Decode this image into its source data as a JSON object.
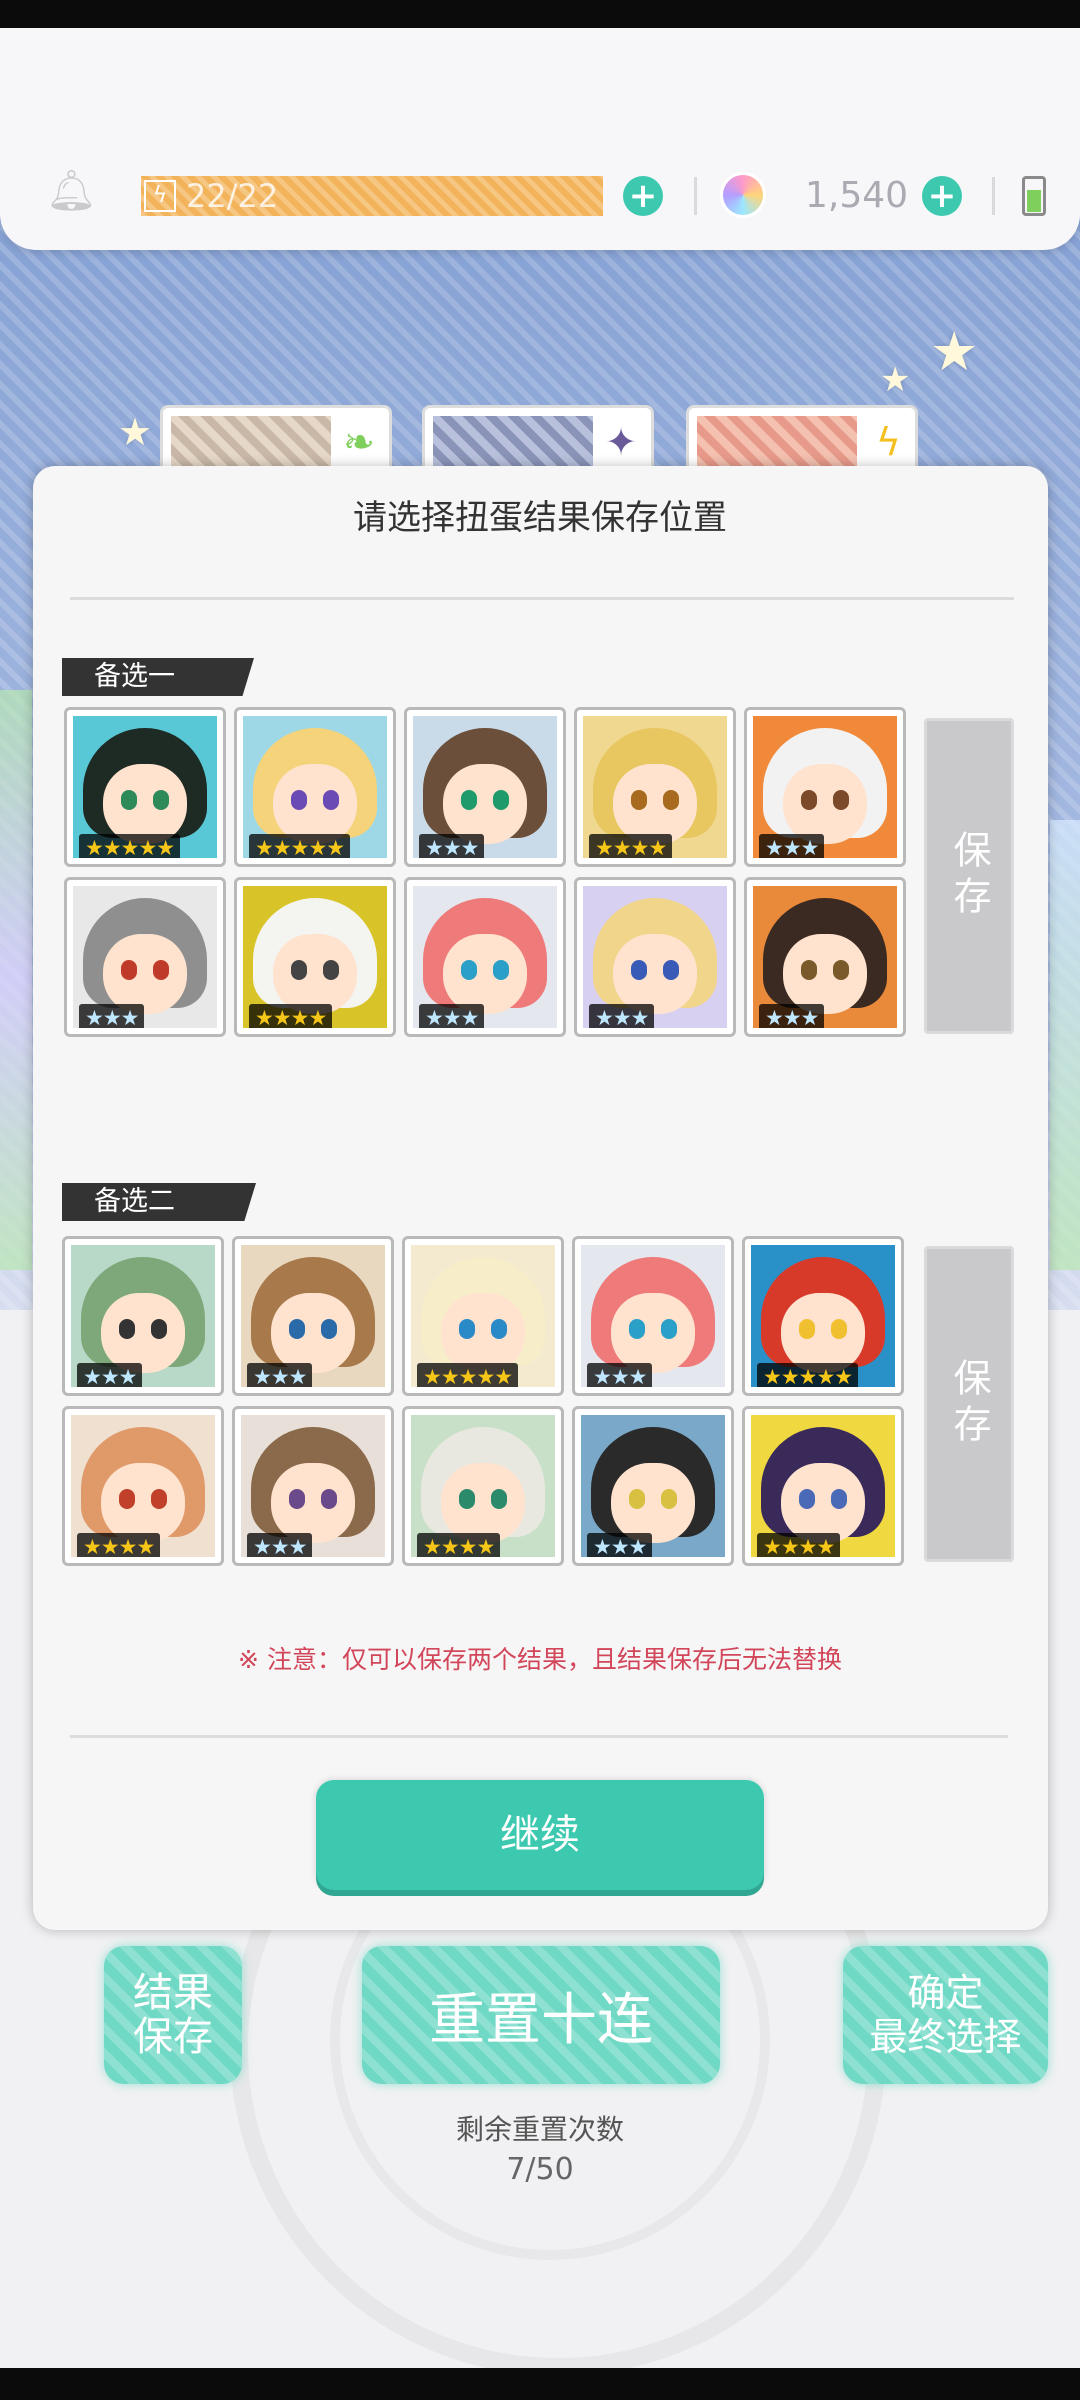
{
  "hud": {
    "stamina": "22/22",
    "gems": "1,540"
  },
  "dialog": {
    "title": "请选择扭蛋结果保存位置",
    "note": "※ 注意：仅可以保存两个结果，且结果保存后无法替换",
    "continue_label": "继续",
    "groups": [
      {
        "label": "备选一",
        "save_label": "保存",
        "characters": [
          {
            "stars": 5,
            "hair": "#1e2a24",
            "bg": "#59c8d6",
            "eye": "#2f8a5a"
          },
          {
            "stars": 5,
            "hair": "#f4d37a",
            "bg": "#9ed8e6",
            "eye": "#6a4bb5"
          },
          {
            "stars": 3,
            "hair": "#6b4f3a",
            "bg": "#c9dbe8",
            "eye": "#1f9a6a"
          },
          {
            "stars": 4,
            "hair": "#e8c660",
            "bg": "#f0d890",
            "eye": "#a86a1e"
          },
          {
            "stars": 3,
            "hair": "#f2f2f2",
            "bg": "#f08a3a",
            "eye": "#7a4a2a"
          },
          {
            "stars": 3,
            "hair": "#8f8f8f",
            "bg": "#e8e8e8",
            "eye": "#c03a2a"
          },
          {
            "stars": 4,
            "hair": "#f4f4f0",
            "bg": "#d8c428",
            "eye": "#444444"
          },
          {
            "stars": 3,
            "hair": "#ef7a7a",
            "bg": "#e4e8ee",
            "eye": "#2aa0c8"
          },
          {
            "stars": 3,
            "hair": "#f1d58a",
            "bg": "#d8d0f0",
            "eye": "#3a5ab8"
          },
          {
            "stars": 3,
            "hair": "#3a2a22",
            "bg": "#e9893a",
            "eye": "#7a5a2a"
          }
        ]
      },
      {
        "label": "备选二",
        "save_label": "保存",
        "characters": [
          {
            "stars": 3,
            "hair": "#7fa87a",
            "bg": "#b8d8c8",
            "eye": "#333333"
          },
          {
            "stars": 3,
            "hair": "#a8794a",
            "bg": "#e8d8c0",
            "eye": "#2a6aa8"
          },
          {
            "stars": 5,
            "hair": "#f7edc8",
            "bg": "#f4ead0",
            "eye": "#2a8ac8"
          },
          {
            "stars": 3,
            "hair": "#ef7a7a",
            "bg": "#e4e8ee",
            "eye": "#2aa0c8"
          },
          {
            "stars": 5,
            "hair": "#d83a2a",
            "bg": "#2a90c8",
            "eye": "#f0c030"
          },
          {
            "stars": 4,
            "hair": "#e09a6a",
            "bg": "#f0e0d0",
            "eye": "#c0402a"
          },
          {
            "stars": 3,
            "hair": "#8a6a4a",
            "bg": "#e8e0d8",
            "eye": "#6a4a8a"
          },
          {
            "stars": 4,
            "hair": "#e8e8e0",
            "bg": "#c8e0c8",
            "eye": "#2a8a6a"
          },
          {
            "stars": 3,
            "hair": "#2a2a2a",
            "bg": "#7aa8c8",
            "eye": "#d8c040"
          },
          {
            "stars": 4,
            "hair": "#3a2a5a",
            "bg": "#f0d840",
            "eye": "#4a6ab8"
          }
        ]
      }
    ]
  },
  "actions": {
    "save_result": "结果\n保存",
    "reset_ten": "重置十连",
    "confirm_final": "确定\n最终选择"
  },
  "remaining": {
    "label": "剩余重置次数",
    "count": "7/50"
  },
  "colors": {
    "accent_teal": "#3cc9b0",
    "stamina_orange": "#f3b35a",
    "note_red": "#d2465a",
    "star_gold": "#f5c518",
    "star_silver": "#bfe6ff"
  }
}
